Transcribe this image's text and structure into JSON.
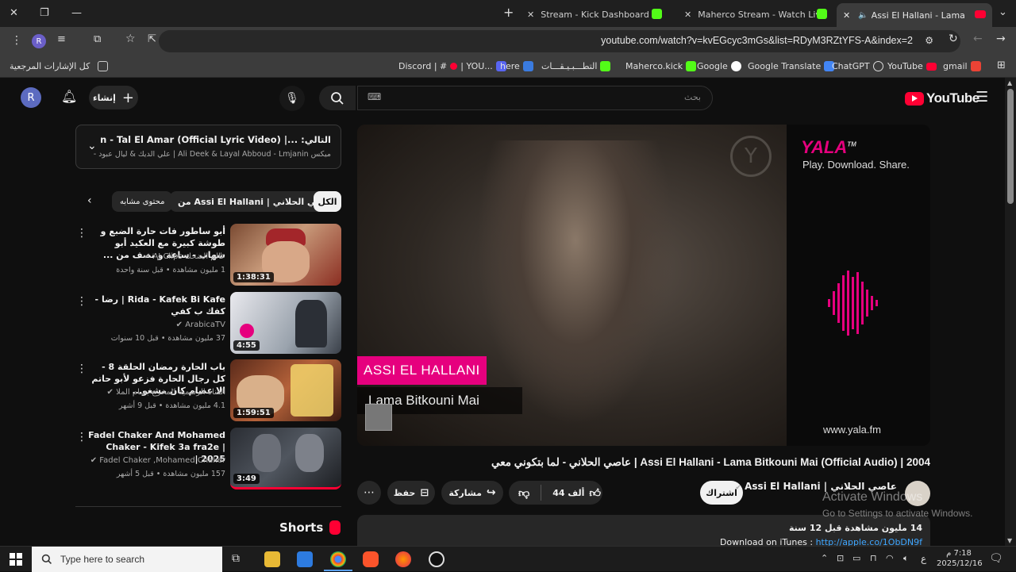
{
  "browser": {
    "tabs": [
      {
        "title": "Stream - Kick Dashboard"
      },
      {
        "title": "Maherco Stream - Watch Live o"
      },
      {
        "title": "Assi El Hallani - Lama Bitkou"
      }
    ],
    "url": "youtube.com/watch?v=kvEGcyc3mGs&list=RDyM3RZtYFS-A&index=2",
    "bookmarks": [
      "كل الإشارات المرجعية",
      "Discord | #",
      "| YOU...",
      "here",
      "التطـــبـيـقـــات",
      "Maherco.kick",
      "Google",
      "Google Translate",
      "ChatGPT",
      "YouTube",
      "gmail"
    ]
  },
  "youtube": {
    "logo": "YouTube",
    "search_placeholder": "بحث",
    "create_label": "إنشاء",
    "avatar_letter": "R",
    "next_up": {
      "label": "التالي:",
      "title": "Toni Qattan - Tal El Amar (Official Lyric Video) |...",
      "subtitle": "ميكس Ali Deek & Layal Abboud - Lmjanin | علي الديك & ليال عبود - لم..."
    },
    "chips": [
      "الكل",
      "من Assi El Hallani | عاصي الحلاني",
      "محتوى مشابه"
    ],
    "related": [
      {
        "title": "أبو ساطور فات حارة الضبع و طوشة كبيرة مع العكيد أبو شهاب - ساعة و نصف من ...",
        "channel": "عالم الضحك AJ Clips",
        "meta": "1 مليون مشاهدة • قبل سنة واحدة",
        "duration": "1:38:31"
      },
      {
        "title": "Rida - Kafek Bi Kafe | رضا - كفك ب كفي",
        "channel": "ArabicaTV",
        "meta": "37 مليون مشاهدة • قبل 10 سنوات",
        "duration": "4:55"
      },
      {
        "title": "باب الحارة رمضان الحلقة 8 - كل رجال الحارة فزعو لأبو حاتم الا عصام كان مشغو...",
        "channel": "القناة الرسمية للمخرج بسام الملا",
        "meta": "4.1 مليون مشاهدة • قبل 9 أشهر",
        "duration": "1:59:51"
      },
      {
        "title": "Fadel Chaker And Mohamed Chaker - Kifek 3a fra2e | 2025 |",
        "channel": "Fadel Chaker ,Mohamed Chaker",
        "meta": "157 مليون مشاهدة • قبل 5 أشهر",
        "duration": "3:49"
      }
    ],
    "shorts_label": "Shorts",
    "video": {
      "artist_banner": "ASSI EL HALLANI",
      "song_banner": "Lama Bitkouni Mai",
      "yala_logo": "YALA",
      "yala_tm": "TM",
      "yala_tagline": "Play. Download. Share.",
      "yala_url": "www.yala.fm",
      "title": "عاصي الحلاني - لما بتكوني معي | Assi El Hallani - Lama Bitkouni Mai (Official Audio) | 2004",
      "channel": "عاصي الحلاني | Assi El Hallani",
      "subscribers": "",
      "subscribe_label": "اشتراك",
      "likes": "44 ألف",
      "share_label": "مشاركة",
      "save_label": "حفظ",
      "views": "14 مليون مشاهدة",
      "age": "قبل 12 سنة",
      "desc_line": "Download on iTunes :",
      "desc_link": "http://apple.co/1ObDN9f"
    }
  },
  "watermark": {
    "line1": "Activate Windows",
    "line2": "Go to Settings to activate Windows."
  },
  "taskbar": {
    "search_placeholder": "Type here to search",
    "time": "7:18 م",
    "date": "2025/12/16",
    "lang": "ع"
  },
  "colors": {
    "accent_red": "#ff0033",
    "kick_green": "#53fc18",
    "banner_pink": "#e6007e"
  }
}
